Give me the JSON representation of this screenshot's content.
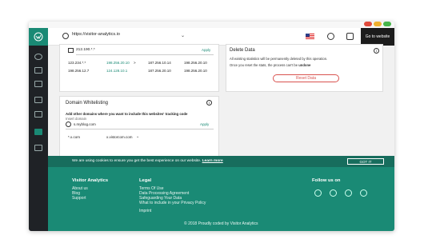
{
  "header": {
    "site_url": "https://visitor-analytics.io",
    "goto_website": "Go to website"
  },
  "ip_card": {
    "ip_input": "212.190.*.*",
    "ip_add_label": "Apply",
    "rows": [
      [
        "123.234.*.*",
        "198.256.20.10",
        ">",
        "187.256.10.14",
        "198.256.20.10"
      ],
      [
        "198.256.12.7",
        "",
        "124.128.10.1",
        "187.256.20.10",
        "198.256.20.10"
      ]
    ]
  },
  "domain_card": {
    "title": "Domain Whitelisting",
    "description": "Add other domains where you want to include this websites' tracking code",
    "insert_label": "Insert domain",
    "domain_input": "s.myblog.com",
    "apply_label": "Apply",
    "entries": [
      "*.x.com",
      "x.vistorcom.com"
    ]
  },
  "delete_card": {
    "title": "Delete Data",
    "line1": "All existing statistics will be permanently deleted by this operation.",
    "line2_prefix": "Once you reset the stats, the process can't be ",
    "line2_bold": "undone",
    "button": "Reset Data"
  },
  "cookie_bar": {
    "text": "We are using cookies to ensure you get the best experience on our website.",
    "learn_more": "Learn more",
    "button": "GOT IT"
  },
  "footer": {
    "brand": "Visitor Analytics",
    "brand_links": [
      "About us",
      "Blog",
      "Support"
    ],
    "legal_title": "Legal",
    "legal_links": [
      "Terms Of Use",
      "Data Processing Agreement",
      "Safeguarding Your Data",
      "What to include in your Privacy Policy"
    ],
    "imprint": "Imprint",
    "follow_title": "Follow us on",
    "copyright": "© 2018 Proudly coded by Visitor Analytics"
  },
  "colors": {
    "brand": "#1a8a75",
    "danger": "#d9534f",
    "sidebar": "#1f2226"
  }
}
